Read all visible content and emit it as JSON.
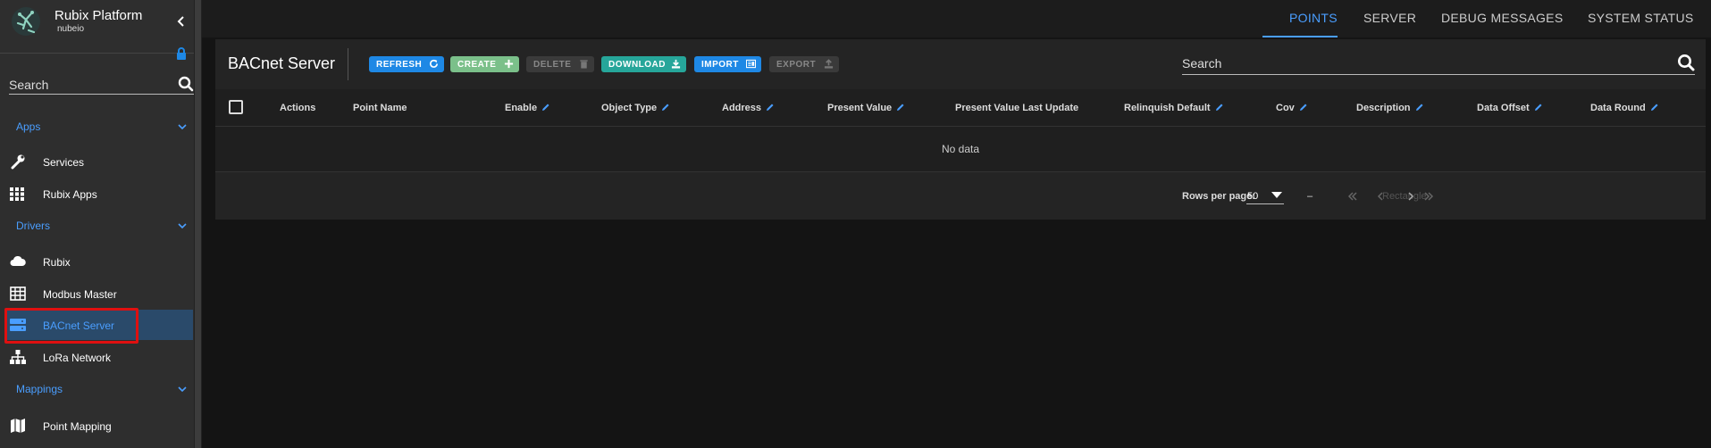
{
  "brand": {
    "title": "Rubix Platform",
    "subtitle": "nubeio"
  },
  "sidebar": {
    "search_placeholder": "Search",
    "sections": [
      {
        "label": "Apps",
        "items": [
          {
            "label": "Services",
            "icon": "wrench-icon"
          },
          {
            "label": "Rubix Apps",
            "icon": "apps-grid-icon"
          }
        ]
      },
      {
        "label": "Drivers",
        "items": [
          {
            "label": "Rubix",
            "icon": "cloud-icon"
          },
          {
            "label": "Modbus Master",
            "icon": "table-grid-icon"
          },
          {
            "label": "BACnet Server",
            "icon": "server-icon",
            "active": true
          },
          {
            "label": "LoRa Network",
            "icon": "network-icon"
          }
        ]
      },
      {
        "label": "Mappings",
        "items": [
          {
            "label": "Point Mapping",
            "icon": "map-icon"
          }
        ]
      }
    ]
  },
  "tabs": [
    {
      "label": "POINTS",
      "active": true
    },
    {
      "label": "SERVER"
    },
    {
      "label": "DEBUG MESSAGES"
    },
    {
      "label": "SYSTEM STATUS"
    }
  ],
  "toolbar": {
    "title": "BACnet Server",
    "buttons": {
      "refresh": "REFRESH",
      "create": "CREATE",
      "delete": "DELETE",
      "download": "DOWNLOAD",
      "import": "IMPORT",
      "export": "EXPORT"
    },
    "search_placeholder": "Search"
  },
  "table": {
    "columns": [
      "Actions",
      "Point Name",
      "Enable",
      "Object Type",
      "Address",
      "Present Value",
      "Present Value Last Update",
      "Relinquish Default",
      "Cov",
      "Description",
      "Data Offset",
      "Data Round"
    ],
    "empty_text": "No data"
  },
  "pagination": {
    "rows_per_page_label": "Rows per page:",
    "rows_per_page": "50",
    "range": "–",
    "overlay_text": "Rectangle"
  },
  "colors": {
    "accent": "#4a9eff",
    "highlight": "#e01010",
    "active_bg": "#2a4a6a"
  }
}
